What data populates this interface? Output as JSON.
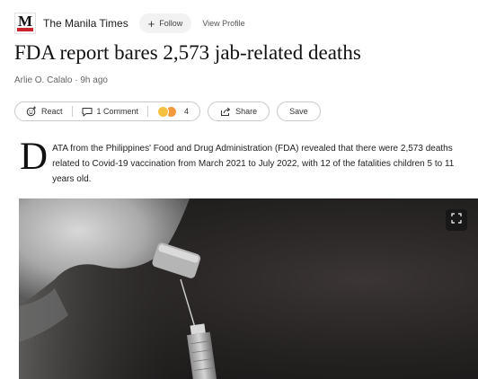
{
  "publisher": {
    "name": "The Manila Times",
    "logo_letter": "M"
  },
  "header": {
    "follow_label": "Follow",
    "view_profile_label": "View Profile"
  },
  "article": {
    "title": "FDA report bares 2,573 jab-related deaths",
    "byline": "Arlie O. Calalo · 9h ago",
    "dropcap": "D",
    "body": "ATA from the Philippines' Food and Drug Administration (FDA) revealed that there were 2,573 deaths related to Covid-19 vaccination from March 2021 to July 2022, with 12 of the fatalities children 5 to 11 years old."
  },
  "actions": {
    "react_label": "React",
    "comment_label": "1 Comment",
    "reaction_count": "4",
    "share_label": "Share",
    "save_label": "Save"
  },
  "colors": {
    "logo_accent": "#c8242b",
    "photo_bg": "#242121"
  },
  "icons": [
    "react-icon",
    "comment-icon",
    "reaction-emoji-icon",
    "share-icon",
    "expand-icon"
  ]
}
